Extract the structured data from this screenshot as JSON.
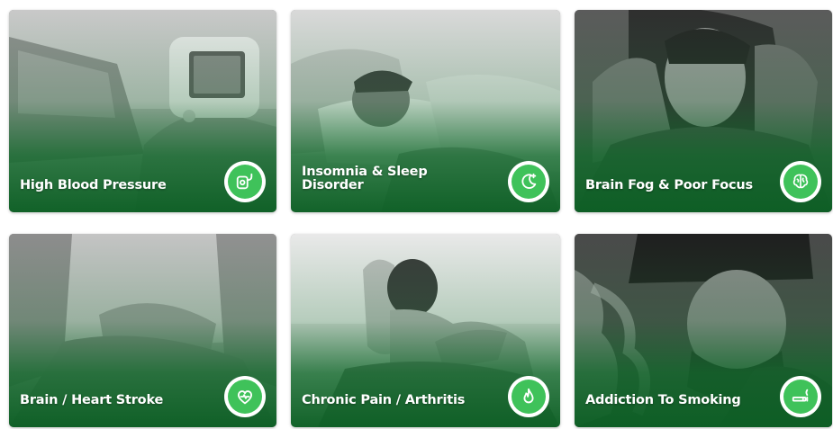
{
  "theme": {
    "accent": "#3fc25a",
    "overlay": "#0f6a2b",
    "badge_ring": "#ffffff"
  },
  "cards": [
    {
      "label": "High Blood Pressure",
      "icon": "blood-pressure-monitor-icon"
    },
    {
      "label": "Insomnia & Sleep Disorder",
      "icon": "moon-stars-icon"
    },
    {
      "label": "Brain Fog & Poor Focus",
      "icon": "brain-icon"
    },
    {
      "label": "Brain / Heart Stroke",
      "icon": "heart-pulse-icon"
    },
    {
      "label": "Chronic Pain / Arthritis",
      "icon": "flame-icon"
    },
    {
      "label": "Addiction To Smoking",
      "icon": "cigarette-icon"
    }
  ]
}
